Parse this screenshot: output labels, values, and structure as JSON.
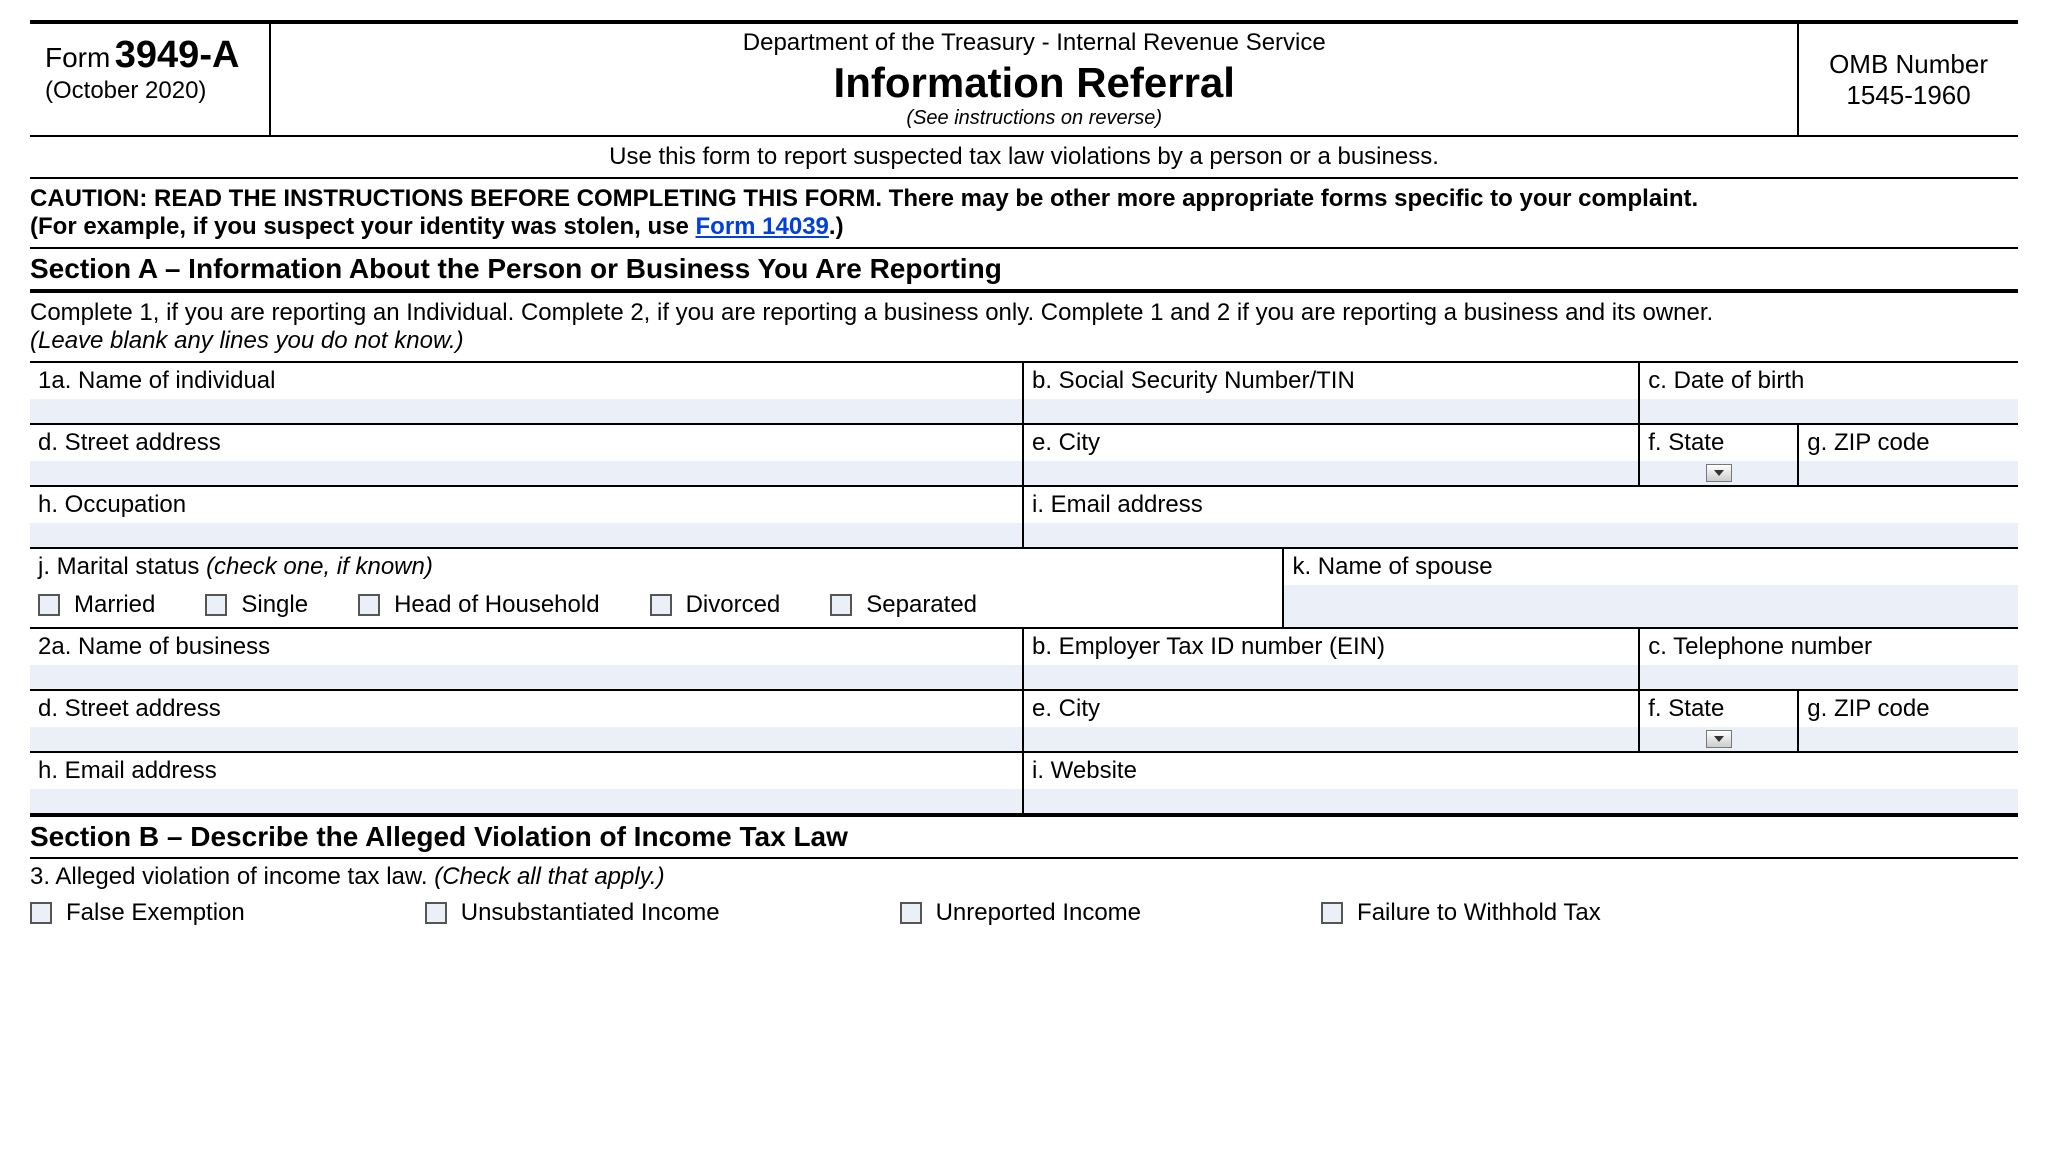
{
  "header": {
    "form_word": "Form",
    "form_number": "3949-A",
    "form_date": "(October 2020)",
    "dept": "Department of the Treasury - Internal Revenue Service",
    "title": "Information Referral",
    "see_instr": "(See instructions on reverse)",
    "omb_label": "OMB Number",
    "omb_number": "1545-1960"
  },
  "usage": "Use this form to report suspected tax law violations by a person or a business.",
  "caution": {
    "line1": "CAUTION: READ THE INSTRUCTIONS BEFORE COMPLETING THIS FORM. There may be other more appropriate forms specific to your complaint.",
    "line2_pre": "(For example, if you suspect your identity was stolen, use ",
    "link_text": "Form 14039",
    "line2_post": ".)"
  },
  "sectionA": {
    "title": "Section A – Information About the Person or Business You Are Reporting",
    "sub_main": "Complete 1, if you are reporting an Individual. Complete 2, if you are reporting a business only. Complete 1 and 2 if you are reporting a business and its owner.",
    "sub_italic": "(Leave blank any lines you do not know.)",
    "f1a": "1a. Name of individual",
    "f1b": "b. Social Security Number/TIN",
    "f1c": "c. Date of birth",
    "f1d": "d. Street address",
    "f1e": "e. City",
    "f1f": "f. State",
    "f1g": "g. ZIP code",
    "f1h": "h. Occupation",
    "f1i": "i. Email address",
    "f1j": "j. Marital status",
    "f1j_hint": "(check one, if known)",
    "marital": [
      "Married",
      "Single",
      "Head of Household",
      "Divorced",
      "Separated"
    ],
    "f1k": "k. Name of spouse",
    "f2a": "2a. Name of business",
    "f2b": "b. Employer Tax ID number (EIN)",
    "f2c": "c. Telephone number",
    "f2d": "d. Street address",
    "f2e": "e. City",
    "f2f": "f. State",
    "f2g": "g. ZIP code",
    "f2h": "h. Email address",
    "f2i": "i. Website"
  },
  "sectionB": {
    "title": "Section B – Describe the Alleged Violation of Income Tax Law",
    "q3": "3. Alleged violation of income tax law.",
    "q3_hint": "(Check all that apply.)",
    "violations": [
      "False Exemption",
      "Unsubstantiated Income",
      "Unreported Income",
      "Failure to Withhold Tax"
    ]
  }
}
